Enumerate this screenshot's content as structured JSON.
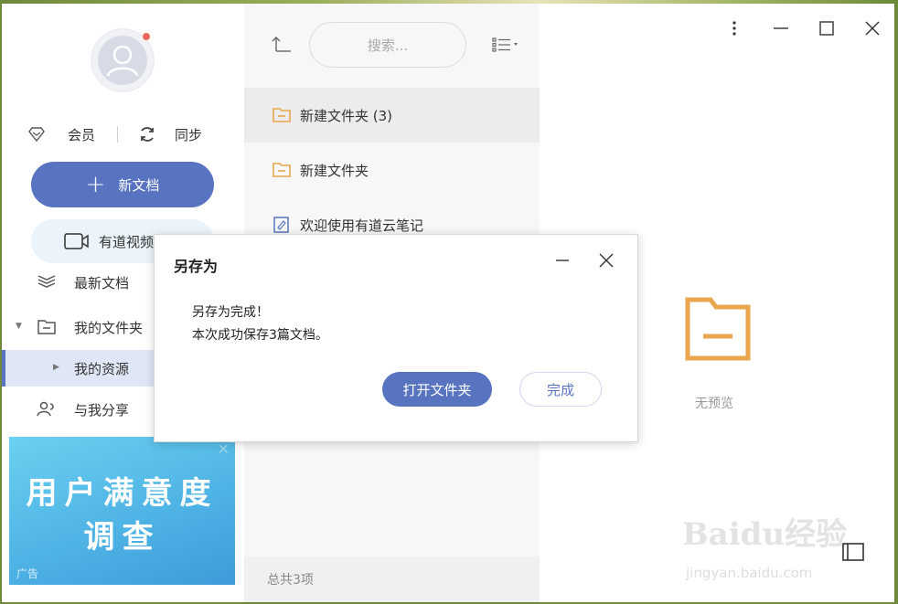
{
  "sidebar": {
    "member_label": "会员",
    "sync_label": "同步",
    "new_doc_label": "新文档",
    "video_label": "有道视频",
    "nav": {
      "recent": "最新文档",
      "my_folders": "我的文件夹",
      "my_resources": "我的资源",
      "shared_with_me": "与我分享"
    },
    "ad": {
      "line1": "用户满意度",
      "line2": "调查",
      "tag": "广告"
    }
  },
  "middle": {
    "search_placeholder": "搜索...",
    "items": [
      {
        "label": "新建文件夹 (3)"
      },
      {
        "label": "新建文件夹"
      },
      {
        "label": "欢迎使用有道云笔记"
      }
    ],
    "footer": "总共3项"
  },
  "preview": {
    "no_preview": "无预览",
    "watermark": "Baidu经验",
    "watermark_sub": "jingyan.baidu.com"
  },
  "dialog": {
    "title": "另存为",
    "message_line1": "另存为完成！",
    "message_line2": "本次成功保存3篇文档。",
    "open_folder_label": "打开文件夹",
    "done_label": "完成"
  },
  "colors": {
    "accent": "#5874c1",
    "folder": "#e8a64d"
  }
}
